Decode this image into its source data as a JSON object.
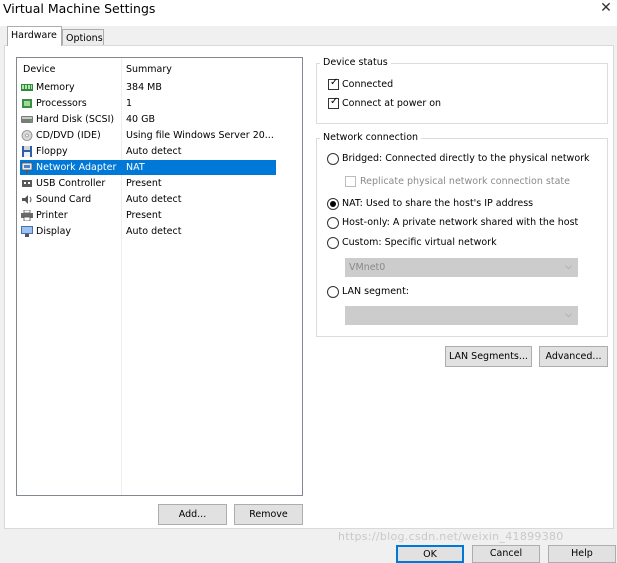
{
  "window": {
    "title": "Virtual Machine Settings",
    "close_glyph": "✕"
  },
  "tabs": [
    {
      "label": "Hardware",
      "active": true
    },
    {
      "label": "Options",
      "active": false
    }
  ],
  "device_list": {
    "columns": {
      "device": "Device",
      "summary": "Summary"
    },
    "rows": [
      {
        "name": "Memory",
        "summary": "384 MB",
        "icon": "memory-icon",
        "selected": false
      },
      {
        "name": "Processors",
        "summary": "1",
        "icon": "processor-icon",
        "selected": false
      },
      {
        "name": "Hard Disk (SCSI)",
        "summary": "40 GB",
        "icon": "hard-disk-icon",
        "selected": false
      },
      {
        "name": "CD/DVD (IDE)",
        "summary": "Using file Windows Server 20...",
        "icon": "cd-dvd-icon",
        "selected": false
      },
      {
        "name": "Floppy",
        "summary": "Auto detect",
        "icon": "floppy-icon",
        "selected": false
      },
      {
        "name": "Network Adapter",
        "summary": "NAT",
        "icon": "network-adapter-icon",
        "selected": true
      },
      {
        "name": "USB Controller",
        "summary": "Present",
        "icon": "usb-icon",
        "selected": false
      },
      {
        "name": "Sound Card",
        "summary": "Auto detect",
        "icon": "sound-card-icon",
        "selected": false
      },
      {
        "name": "Printer",
        "summary": "Present",
        "icon": "printer-icon",
        "selected": false
      },
      {
        "name": "Display",
        "summary": "Auto detect",
        "icon": "display-icon",
        "selected": false
      }
    ],
    "add_label": "Add...",
    "remove_label": "Remove"
  },
  "device_status": {
    "title": "Device status",
    "connected_label": "Connected",
    "connected": true,
    "connect_at_power_on_label": "Connect at power on",
    "connect_at_power_on": true
  },
  "network_connection": {
    "title": "Network connection",
    "bridged_label": "Bridged: Connected directly to the physical network",
    "replicate_label": "Replicate physical network connection state",
    "nat_label": "NAT: Used to share the host's IP address",
    "host_only_label": "Host-only: A private network shared with the host",
    "custom_label": "Custom: Specific virtual network",
    "custom_value": "VMnet0",
    "lan_segment_label": "LAN segment:",
    "lan_segment_value": "",
    "selected": "nat",
    "check_glyph": "✓",
    "arrow_glyph": "⌵"
  },
  "buttons": {
    "lan_segments_label": "LAN Segments...",
    "advanced_label": "Advanced...",
    "ok_label": "OK",
    "cancel_label": "Cancel",
    "help_label": "Help"
  },
  "watermark": "https://blog.csdn.net/weixin_41899380",
  "colors": {
    "selection": "#0078d7",
    "window_bg": "#f0f0f0",
    "panel_bg": "#ffffff"
  }
}
